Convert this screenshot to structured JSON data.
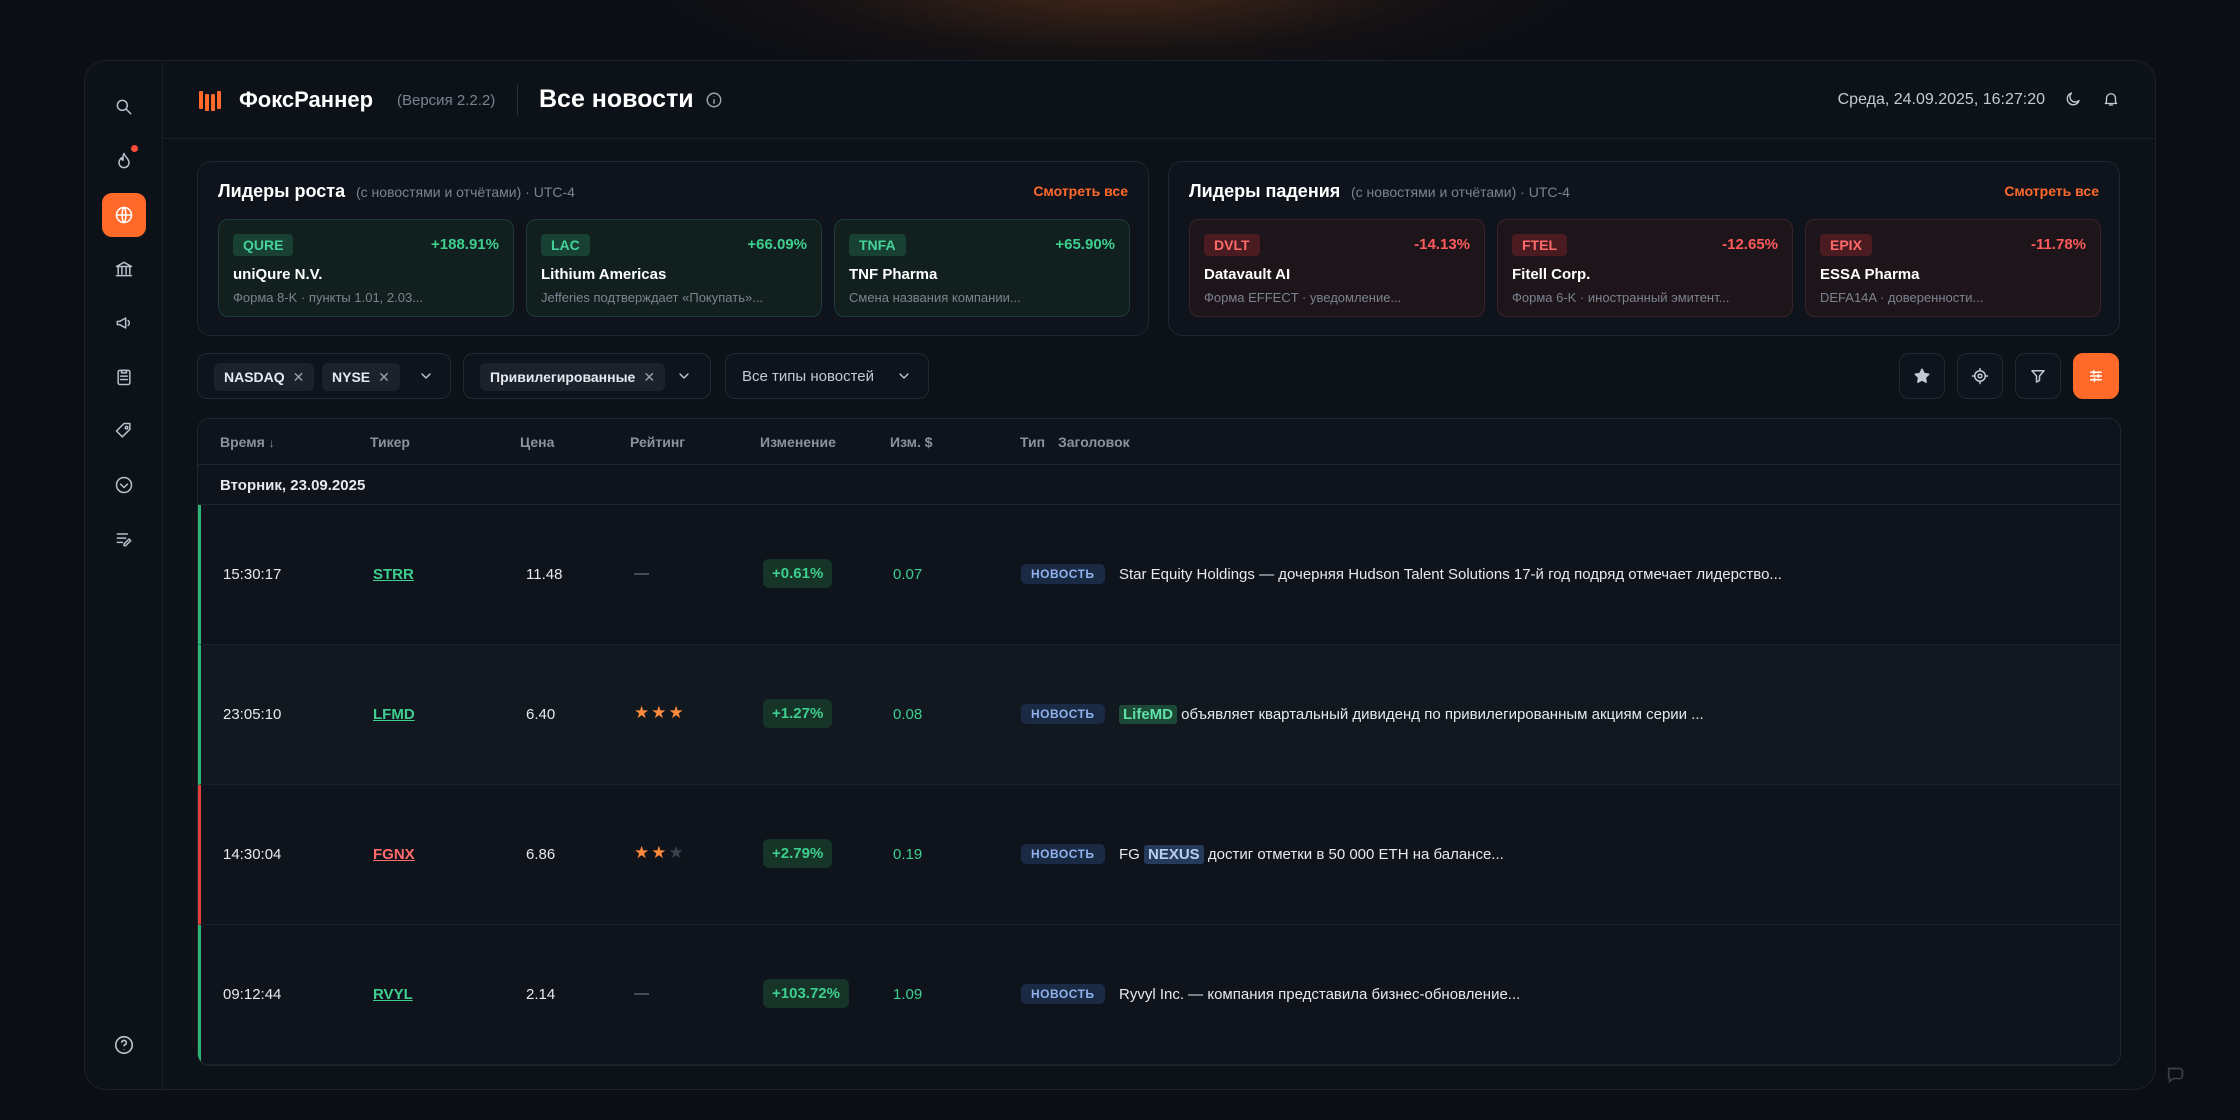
{
  "app": {
    "name": "ФоксРаннер",
    "version": "(Версия 2.2.2)",
    "page_title": "Все новости",
    "datetime": "Среда, 24.09.2025, 16:27:20"
  },
  "colors": {
    "accent": "#ff6a2b",
    "up": "#3ecf8e",
    "down": "#ff5a5a"
  },
  "sidebar": {
    "items": [
      {
        "icon": "search-icon"
      },
      {
        "icon": "fire-icon",
        "badge": true
      },
      {
        "icon": "globe-icon",
        "active": true
      },
      {
        "icon": "bank-icon"
      },
      {
        "icon": "megaphone-icon"
      },
      {
        "icon": "clipboard-icon"
      },
      {
        "icon": "tag-icon"
      },
      {
        "icon": "chevron-circle-icon"
      },
      {
        "icon": "edit-list-icon"
      }
    ],
    "help_icon": "help-icon"
  },
  "gainers": {
    "title": "Лидеры роста",
    "subtitle": "(с новостями и отчётами) · UTC-4",
    "see_all": "Смотреть все",
    "cards": [
      {
        "ticker": "QURE",
        "change": "+188.91%",
        "name": "uniQure N.V.",
        "desc": "Форма 8-K · пункты 1.01, 2.03..."
      },
      {
        "ticker": "LAC",
        "change": "+66.09%",
        "name": "Lithium Americas",
        "desc": "Jefferies подтверждает «Покупать»..."
      },
      {
        "ticker": "TNFA",
        "change": "+65.90%",
        "name": "TNF Pharma",
        "desc": "Смена названия компании..."
      }
    ]
  },
  "losers": {
    "title": "Лидеры падения",
    "subtitle": "(с новостями и отчётами) · UTC-4",
    "see_all": "Смотреть все",
    "cards": [
      {
        "ticker": "DVLT",
        "change": "-14.13%",
        "name": "Datavault AI",
        "desc": "Форма EFFECT · уведомление..."
      },
      {
        "ticker": "FTEL",
        "change": "-12.65%",
        "name": "Fitell Corp.",
        "desc": "Форма 6-K · иностранный эмитент..."
      },
      {
        "ticker": "EPIX",
        "change": "-11.78%",
        "name": "ESSA Pharma",
        "desc": "DEFA14A · доверенности..."
      }
    ]
  },
  "filters": {
    "exchanges": [
      "NASDAQ",
      "NYSE"
    ],
    "security": "Привилегированные",
    "news_type": "Все типы новостей"
  },
  "table": {
    "columns": {
      "time": "Время",
      "ticker": "Тикер",
      "price": "Цена",
      "rating": "Рейтинг",
      "change": "Изменение",
      "change_usd": "Изм. $",
      "type": "Тип",
      "headline": "Заголовок"
    },
    "date_group": "Вторник, 23.09.2025",
    "rows": [
      {
        "time": "15:30:17",
        "ticker": "STRR",
        "price": "11.48",
        "rating": "—",
        "change": "+0.61%",
        "change_usd": "0.07",
        "type": "НОВОСТЬ",
        "headline_pre": "",
        "headline_tag": "",
        "headline": "Star Equity Holdings — дочерняя Hudson Talent Solutions 17-й год подряд отмечает лидерство..."
      },
      {
        "time": "23:05:10",
        "ticker": "LFMD",
        "price": "6.40",
        "rating": 3,
        "change": "+1.27%",
        "change_usd": "0.08",
        "type": "НОВОСТЬ",
        "headline_pre": "",
        "headline_tag": "LifeMD",
        "headline": " объявляет квартальный дивиденд по привилегированным акциям серии ..."
      },
      {
        "time": "14:30:04",
        "ticker": "FGNX",
        "price": "6.86",
        "rating": 2,
        "change": "+2.79%",
        "change_usd": "0.19",
        "type": "НОВОСТЬ",
        "headline_pre": "FG ",
        "headline_tag": "NEXUS",
        "headline": " достиг отметки в 50 000 ETH на балансе..."
      },
      {
        "time": "09:12:44",
        "ticker": "RVYL",
        "price": "2.14",
        "rating": "—",
        "change": "+103.72%",
        "change_usd": "1.09",
        "type": "НОВОСТЬ",
        "headline_pre": "",
        "headline_tag": "",
        "headline": "Ryvyl Inc. — компания представила бизнес-обновление..."
      }
    ]
  }
}
